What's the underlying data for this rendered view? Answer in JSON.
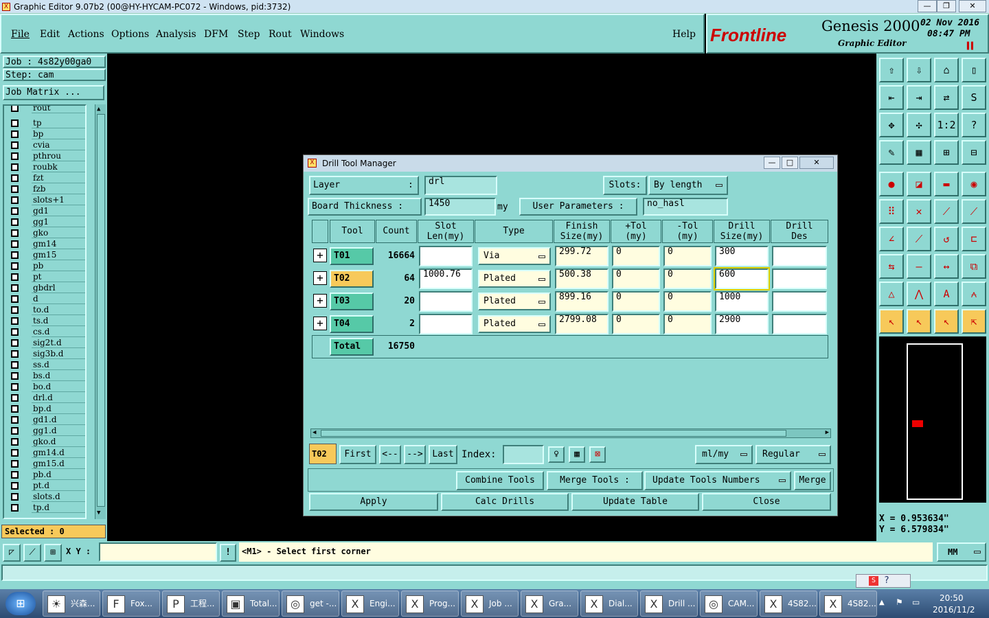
{
  "window": {
    "title": "Graphic Editor 9.07b2 (00@HY-HYCAM-PC072 - Windows, pid:3732)"
  },
  "menu": [
    "File",
    "Edit",
    "Actions",
    "Options",
    "Analysis",
    "DFM",
    "Step",
    "Rout",
    "Windows"
  ],
  "help": "Help",
  "brand": {
    "logo": "Frontline",
    "product": "Genesis 2000",
    "subtitle": "Graphic Editor",
    "date": "02 Nov 2016",
    "time": "08:47 PM"
  },
  "left": {
    "job": "Job : 4s82y00ga0",
    "step": "Step: cam",
    "job_matrix": "Job Matrix ...",
    "layers": [
      {
        "name": "rout",
        "mark": ""
      },
      {
        "name": "tp",
        "mark": ""
      },
      {
        "name": "bp",
        "mark": ""
      },
      {
        "name": "cvia",
        "mark": ""
      },
      {
        "name": "pthrou",
        "mark": ""
      },
      {
        "name": "roubk",
        "mark": ""
      },
      {
        "name": "fzt",
        "mark": ""
      },
      {
        "name": "fzb",
        "mark": ""
      },
      {
        "name": "slots+1",
        "mark": ""
      },
      {
        "name": "gd1",
        "mark": "◢"
      },
      {
        "name": "gg1",
        "mark": ""
      },
      {
        "name": "gko",
        "mark": ""
      },
      {
        "name": "gm14",
        "mark": "◢"
      },
      {
        "name": "gm15",
        "mark": ""
      },
      {
        "name": "pb",
        "mark": ""
      },
      {
        "name": "pt",
        "mark": ""
      },
      {
        "name": "gbdrl",
        "mark": ""
      },
      {
        "name": "d",
        "mark": ""
      },
      {
        "name": "to.d",
        "mark": "◢"
      },
      {
        "name": "ts.d",
        "mark": ""
      },
      {
        "name": "cs.d",
        "mark": "◢"
      },
      {
        "name": "sig2t.d",
        "mark": ""
      },
      {
        "name": "sig3b.d",
        "mark": "◢"
      },
      {
        "name": "ss.d",
        "mark": "◢"
      },
      {
        "name": "bs.d",
        "mark": ""
      },
      {
        "name": "bo.d",
        "mark": ""
      },
      {
        "name": "drl.d",
        "mark": ""
      },
      {
        "name": "bp.d",
        "mark": ""
      },
      {
        "name": "gd1.d",
        "mark": "◢"
      },
      {
        "name": "gg1.d",
        "mark": ""
      },
      {
        "name": "gko.d",
        "mark": ""
      },
      {
        "name": "gm14.d",
        "mark": "◢"
      },
      {
        "name": "gm15.d",
        "mark": ""
      },
      {
        "name": "pb.d",
        "mark": ""
      },
      {
        "name": "pt.d",
        "mark": ""
      },
      {
        "name": "slots.d",
        "mark": ""
      },
      {
        "name": "tp.d",
        "mark": ""
      }
    ],
    "selected": "Selected : 0"
  },
  "coords": {
    "x": "X = 0.953634\"",
    "y": "Y = 6.579834\""
  },
  "dialog": {
    "title": "Drill Tool Manager",
    "layer_label": "Layer",
    "layer_colon": ":",
    "layer_value": "drl",
    "slots_label": "Slots:",
    "slots_value": "By length",
    "thickness_label": "Board Thickness :",
    "thickness_value": "1450",
    "thickness_unit": "my",
    "userparams_label": "User Parameters :",
    "userparams_value": "no_hasl",
    "headers": {
      "tool": "Tool",
      "count": "Count",
      "slot1": "Slot",
      "slot2": "Len(my)",
      "type": "Type",
      "finish1": "Finish",
      "finish2": "Size(my)",
      "ptol1": "+Tol",
      "ptol2": "(my)",
      "mtol1": "-Tol",
      "mtol2": "(my)",
      "drill1": "Drill",
      "drill2": "Size(my)",
      "des1": "Drill",
      "des2": "Des"
    },
    "rows": [
      {
        "tool": "T01",
        "count": "16664",
        "slot": "",
        "type": "Via",
        "finish": "299.72",
        "ptol": "0",
        "mtol": "0",
        "drill": "300",
        "des": ""
      },
      {
        "tool": "T02",
        "count": "64",
        "slot": "1000.76",
        "type": "Plated",
        "finish": "500.38",
        "ptol": "0",
        "mtol": "0",
        "drill": "600",
        "des": ""
      },
      {
        "tool": "T03",
        "count": "20",
        "slot": "",
        "type": "Plated",
        "finish": "899.16",
        "ptol": "0",
        "mtol": "0",
        "drill": "1000",
        "des": ""
      },
      {
        "tool": "T04",
        "count": "2",
        "slot": "",
        "type": "Plated",
        "finish": "2799.08",
        "ptol": "0",
        "mtol": "0",
        "drill": "2900",
        "des": ""
      }
    ],
    "total_label": "Total",
    "total_count": "16750",
    "current_tool": "T02",
    "nav": {
      "first": "First",
      "prev": "<--",
      "next": "-->",
      "last": "Last",
      "index": "Index:"
    },
    "units": "ml/my",
    "mode": "Regular",
    "combine": "Combine Tools",
    "merge_tools": "Merge Tools :",
    "update_numbers": "Update Tools Numbers",
    "merge": "Merge",
    "apply": "Apply",
    "calc": "Calc Drills",
    "update_table": "Update Table",
    "close": "Close"
  },
  "status": {
    "xy_label": "X Y :",
    "prompt": "<M1> - Select first corner",
    "unit": "MM"
  },
  "taskbar": {
    "items": [
      "兴森...",
      "Fox...",
      "工程...",
      "Total...",
      "get -...",
      "Engi...",
      "Prog...",
      "Job ...",
      "Gra...",
      "Dial...",
      "Drill ...",
      "CAM...",
      "4S82...",
      "4S82..."
    ],
    "time": "20:50",
    "date": "2016/11/2"
  }
}
